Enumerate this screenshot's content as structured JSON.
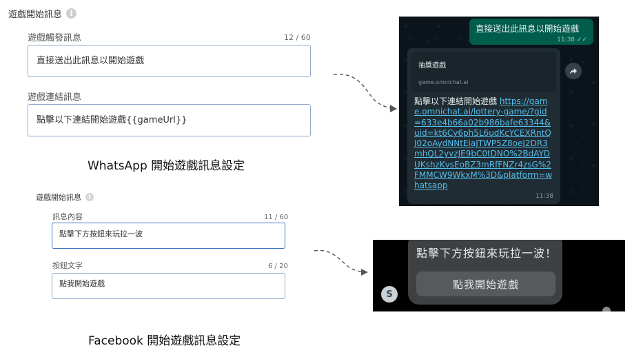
{
  "whatsapp_settings": {
    "section_title": "遊戲開始訊息",
    "trigger_label": "遊戲觸發訊息",
    "trigger_counter": "12 / 60",
    "trigger_value": "直接送出此訊息以開始遊戲",
    "link_label": "遊戲連結訊息",
    "link_value": "點擊以下連結開始遊戲{{gameUrl}}",
    "caption": "WhatsApp 開始遊戲訊息設定"
  },
  "facebook_settings": {
    "section_title": "遊戲開始訊息",
    "content_label": "訊息內容",
    "content_counter": "11 / 60",
    "content_value": "點擊下方按鈕來玩拉一波",
    "button_label": "按鈕文字",
    "button_counter": "6 / 20",
    "button_value": "點我開始遊戲",
    "caption": "Facebook 開始遊戲訊息設定"
  },
  "whatsapp_preview": {
    "outgoing_text": "直接送出此訊息以開始遊戲",
    "outgoing_time": "11:38",
    "card_title": "抽獎遊戲",
    "card_domain": "game.omnichat.ai",
    "body_text": "點擊以下連結開始遊戲 ",
    "body_link": "https://game.omnichat.ai/lottery-game/?gid=633e4b66a02b986bafe63344&uid=kt6Cy6ph5L6udKcYCEXRntQJ02oAydNNtEiaJTWP5Z8oeJ2DR3mhQL2yvzJE9bC0tDNO%2BdAYDUKshzKvsEoBZ3mRfFNZr4zsG%2FMMCW9WkxM%3D&platform=whatsapp",
    "incoming_time": "11:38",
    "colors": {
      "outgoing": "#005c4b",
      "incoming": "#202c33",
      "link": "#53bdeb"
    }
  },
  "messenger_preview": {
    "message_text": "點擊下方按鈕來玩拉一波！",
    "button_text": "點我開始遊戲",
    "avatar_letter": "S"
  }
}
